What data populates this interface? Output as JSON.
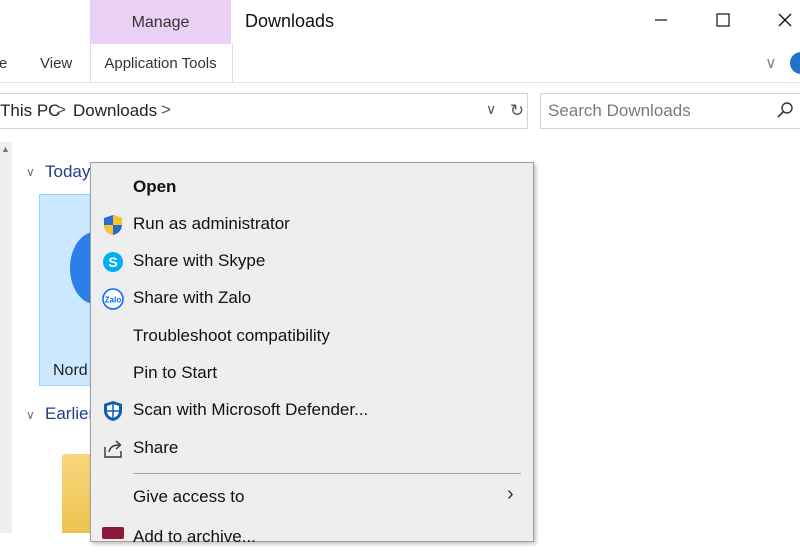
{
  "window": {
    "title": "Downloads",
    "contextual_tab_group": "Manage",
    "minimize_glyph": "—",
    "maximize_glyph": "☐",
    "close_glyph": "✕"
  },
  "ribbon": {
    "tabs": [
      {
        "label": "e"
      },
      {
        "label": "View"
      },
      {
        "label": "Application Tools"
      }
    ],
    "expand_glyph": "∨"
  },
  "address": {
    "crumbs": [
      "This PC",
      "Downloads"
    ],
    "separator": ">",
    "dropdown_glyph": "∨",
    "refresh_glyph": "↻"
  },
  "search": {
    "placeholder": "Search Downloads"
  },
  "content": {
    "groups": [
      {
        "label": "Today"
      },
      {
        "label": "Earlier"
      }
    ],
    "group_chevron": "∨",
    "files": [
      {
        "label": "Nord"
      }
    ]
  },
  "context_menu": {
    "items": [
      {
        "label": "Open",
        "icon": "none"
      },
      {
        "label": "Run as administrator",
        "icon": "uac-shield-icon"
      },
      {
        "label": "Share with Skype",
        "icon": "skype-icon"
      },
      {
        "label": "Share with Zalo",
        "icon": "zalo-icon"
      },
      {
        "label": "Troubleshoot compatibility",
        "icon": "none"
      },
      {
        "label": "Pin to Start",
        "icon": "none"
      },
      {
        "label": "Scan with Microsoft Defender...",
        "icon": "defender-shield-icon"
      },
      {
        "label": "Share",
        "icon": "share-icon"
      },
      {
        "label": "Give access to",
        "icon": "none"
      },
      {
        "label": "Add to archive...",
        "icon": "winrar-icon"
      }
    ],
    "submenu_glyph": "›",
    "partial_item_label": "Add to archive..."
  },
  "colors": {
    "manage_tab": "#ead0f4",
    "selection": "#cce8ff",
    "group_header": "#1f3f8a",
    "menu_bg": "#eeeeee",
    "skype_blue": "#00aff0",
    "defender_blue": "#0a5fb4",
    "zalo_blue": "#0068ff"
  }
}
